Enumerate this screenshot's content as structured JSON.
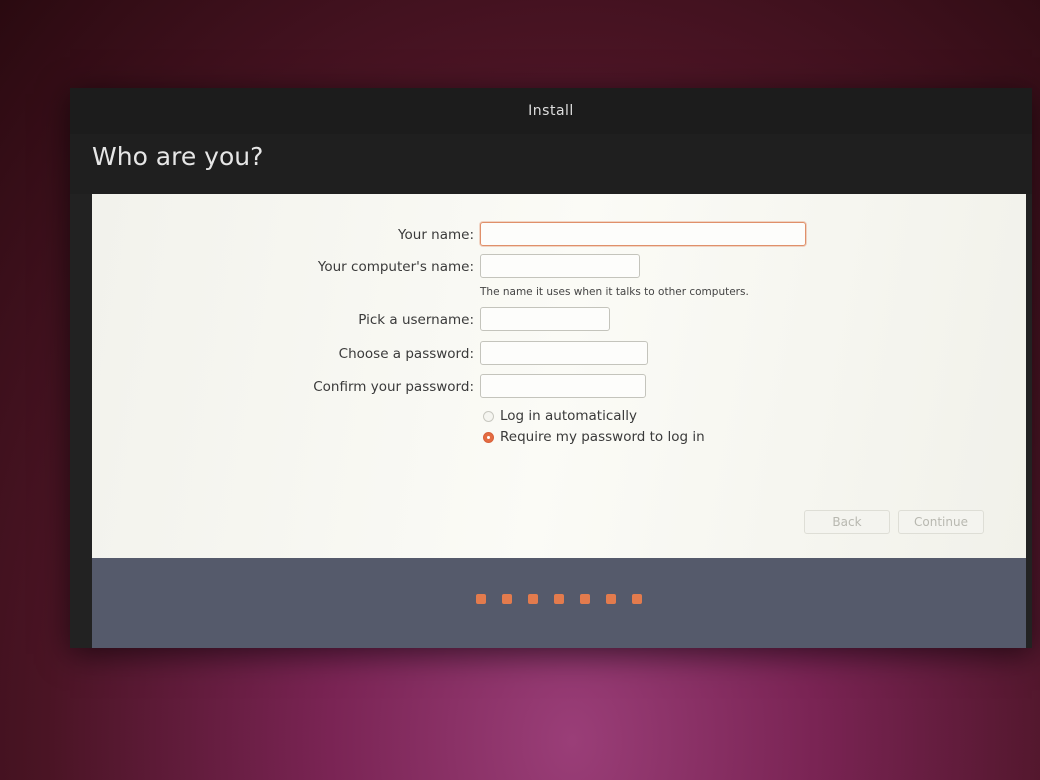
{
  "window": {
    "title": "Install"
  },
  "page": {
    "title": "Who are you?"
  },
  "form": {
    "your_name": {
      "label": "Your name:",
      "value": ""
    },
    "computer_name": {
      "label": "Your computer's name:",
      "value": "",
      "hint": "The name it uses when it talks to other computers."
    },
    "username": {
      "label": "Pick a username:",
      "value": ""
    },
    "password": {
      "label": "Choose a password:",
      "value": ""
    },
    "confirm_password": {
      "label": "Confirm your password:",
      "value": ""
    },
    "login_options": [
      {
        "label": "Log in automatically",
        "selected": false
      },
      {
        "label": "Require my password to log in",
        "selected": true
      }
    ]
  },
  "buttons": {
    "back": "Back",
    "continue": "Continue"
  },
  "progress": {
    "step_count": 7
  },
  "colors": {
    "accent": "#e37b4d",
    "footer": "#555a6b",
    "header": "#1f1f1f"
  }
}
